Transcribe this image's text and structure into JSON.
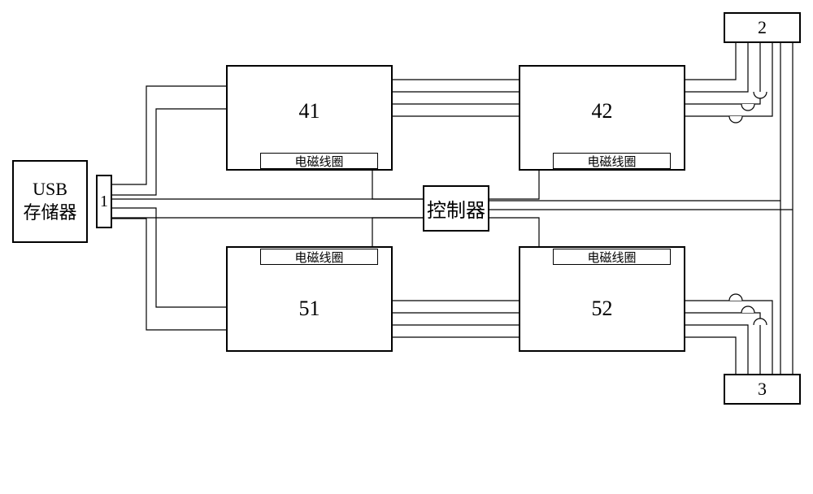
{
  "usb": {
    "line1": "USB",
    "line2": "存储器"
  },
  "port1": {
    "label": "1"
  },
  "relay41": {
    "label": "41",
    "coil": "电磁线圈"
  },
  "relay42": {
    "label": "42",
    "coil": "电磁线圈"
  },
  "relay51": {
    "label": "51",
    "coil": "电磁线圈"
  },
  "relay52": {
    "label": "52",
    "coil": "电磁线圈"
  },
  "controller": {
    "label": "控制器"
  },
  "block2": {
    "label": "2"
  },
  "block3": {
    "label": "3"
  }
}
